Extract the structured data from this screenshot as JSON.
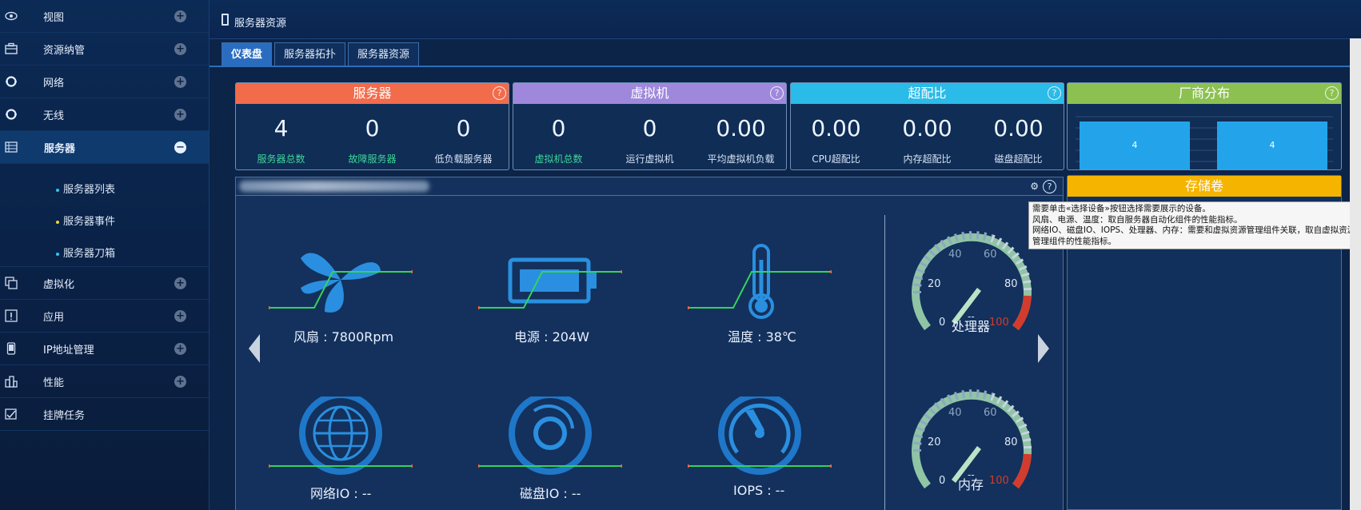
{
  "sidebar": {
    "items": [
      {
        "label": "视图",
        "icon": "eye-icon",
        "state": "collapsed"
      },
      {
        "label": "资源纳管",
        "icon": "briefcase-icon",
        "state": "collapsed"
      },
      {
        "label": "网络",
        "icon": "ring-icon",
        "state": "collapsed"
      },
      {
        "label": "无线",
        "icon": "ring-icon",
        "state": "collapsed"
      },
      {
        "label": "服务器",
        "icon": "server-icon",
        "state": "expanded"
      },
      {
        "label": "虚拟化",
        "icon": "copy-icon",
        "state": "collapsed"
      },
      {
        "label": "应用",
        "icon": "info-box-icon",
        "state": "collapsed"
      },
      {
        "label": "IP地址管理",
        "icon": "phone-icon",
        "state": "collapsed"
      },
      {
        "label": "性能",
        "icon": "chart-icon",
        "state": "collapsed"
      },
      {
        "label": "挂牌任务",
        "icon": "task-icon",
        "state": "none"
      }
    ],
    "subitems": [
      "服务器列表",
      "服务器事件",
      "服务器刀箱"
    ]
  },
  "header": {
    "title": "服务器资源"
  },
  "tabs": [
    {
      "label": "仪表盘",
      "active": true
    },
    {
      "label": "服务器拓扑",
      "active": false
    },
    {
      "label": "服务器资源",
      "active": false
    }
  ],
  "cards": {
    "server": {
      "title": "服务器",
      "color": "#f26b4b",
      "stats": [
        {
          "value": "4",
          "label": "服务器总数"
        },
        {
          "value": "0",
          "label": "故障服务器"
        },
        {
          "value": "0",
          "label": "低负载服务器"
        }
      ]
    },
    "vm": {
      "title": "虚拟机",
      "color": "#9f88dc",
      "stats": [
        {
          "value": "0",
          "label": "虚拟机总数"
        },
        {
          "value": "0",
          "label": "运行虚拟机"
        },
        {
          "value": "0.00",
          "label": "平均虚拟机负载"
        }
      ]
    },
    "overcommit": {
      "title": "超配比",
      "color": "#2bbbe8",
      "stats": [
        {
          "value": "0.00",
          "label": "CPU超配比"
        },
        {
          "value": "0.00",
          "label": "内存超配比"
        },
        {
          "value": "0.00",
          "label": "磁盘超配比"
        }
      ]
    },
    "vendor": {
      "title": "厂商分布",
      "color": "#8cc152",
      "bars": [
        "4",
        "4"
      ]
    }
  },
  "help_char": "?",
  "panel": {
    "metrics": [
      {
        "label": "风扇 : 7800Rpm",
        "icon": "fan-icon"
      },
      {
        "label": "电源 : 204W",
        "icon": "battery-icon"
      },
      {
        "label": "温度 : 38℃",
        "icon": "thermometer-icon"
      },
      {
        "label": "网络IO : --",
        "icon": "globe-icon"
      },
      {
        "label": "磁盘IO : --",
        "icon": "disk-icon"
      },
      {
        "label": "IOPS : --",
        "icon": "speedometer-icon"
      }
    ],
    "gauges": [
      {
        "name": "处理器",
        "readout": "--",
        "ticks": [
          "0",
          "20",
          "40",
          "60",
          "80",
          "100"
        ]
      },
      {
        "name": "内存",
        "readout": "--",
        "ticks": [
          "0",
          "20",
          "40",
          "60",
          "80",
          "100"
        ]
      }
    ]
  },
  "storage": {
    "title": "存储卷"
  },
  "tooltip": {
    "lines": [
      "需要单击«选择设备»按钮选择需要展示的设备。",
      "风扇、电源、温度：取自服务器自动化组件的性能指标。",
      "网络IO、磁盘IO、IOPS、处理器、内存：需要和虚拟资源管理组件关联，取自虚拟资源",
      "管理组件的性能指标。"
    ]
  }
}
